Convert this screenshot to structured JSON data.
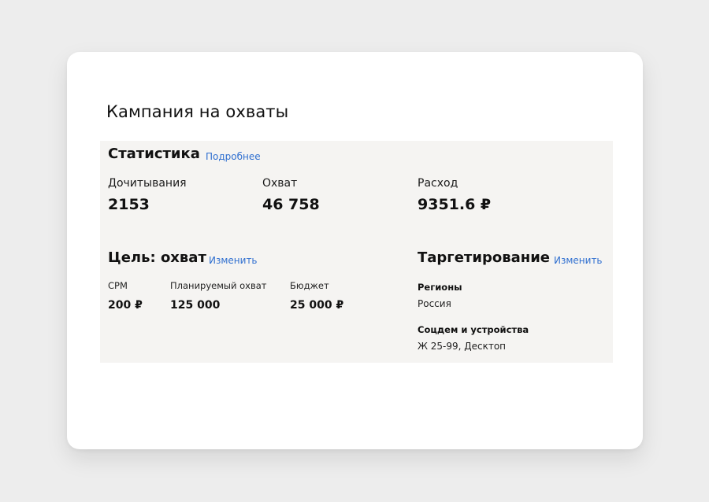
{
  "card": {
    "title": "Кампания на охваты"
  },
  "statistics": {
    "title": "Статистика",
    "link": "Подробнее",
    "metrics": [
      {
        "label": "Дочитывания",
        "value": "2153"
      },
      {
        "label": "Охват",
        "value": "46 758"
      },
      {
        "label": "Расход",
        "value": "9351.6 ₽"
      }
    ]
  },
  "goal": {
    "title": "Цель: охват",
    "link": "Изменить",
    "items": [
      {
        "label": "CPM",
        "value": "200 ₽"
      },
      {
        "label": "Планируемый охват",
        "value": "125 000"
      },
      {
        "label": "Бюджет",
        "value": "25 000 ₽"
      }
    ]
  },
  "targeting": {
    "title": "Таргетирование",
    "link": "Изменить",
    "items": [
      {
        "label": "Регионы",
        "value": "Россия"
      },
      {
        "label": "Соцдем и устройства",
        "value": "Ж 25-99, Десктоп"
      }
    ]
  },
  "colors": {
    "background": "#ededed",
    "card": "#ffffff",
    "panel": "#f5f4f2",
    "link": "#2f6fd0"
  }
}
